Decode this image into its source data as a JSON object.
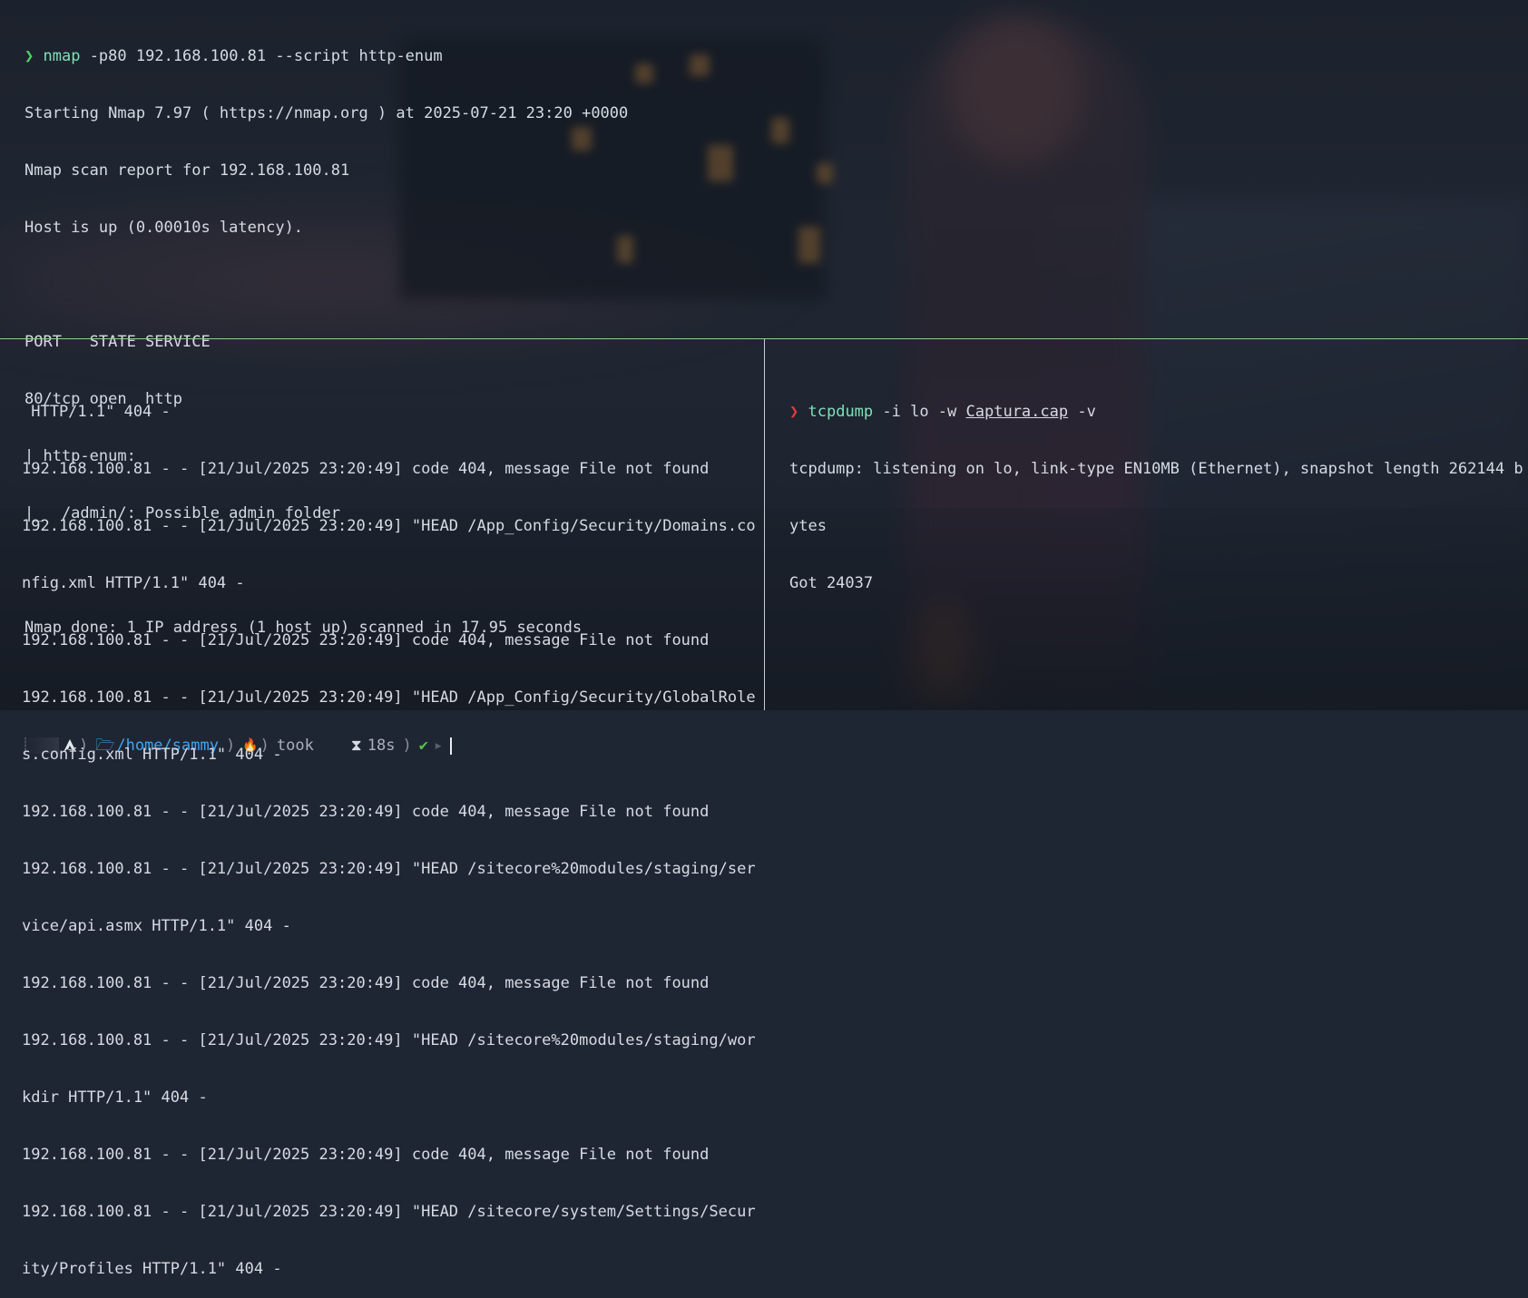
{
  "top_pane": {
    "prompt_symbol": "❯",
    "command_name": "nmap",
    "command_args": " -p80 192.168.100.81 --script http-enum",
    "output": [
      "Starting Nmap 7.97 ( https://nmap.org ) at 2025-07-21 23:20 +0000",
      "Nmap scan report for 192.168.100.81",
      "Host is up (0.00010s latency).",
      "",
      "PORT   STATE SERVICE",
      "80/tcp open  http",
      "| http-enum:",
      "|_  /admin/: Possible admin folder",
      "",
      "Nmap done: 1 IP address (1 host up) scanned in 17.95 seconds"
    ],
    "status_prompt": {
      "os_icon": "arch-linux-icon",
      "folder_icon": "folder-icon",
      "path": "/home/sammy",
      "fire_icon": "fire-icon",
      "took_label": "took",
      "hourglass_icon": "hourglass-icon",
      "duration": "18s",
      "status_icon": "check-icon",
      "separator": ")"
    }
  },
  "left_pane": {
    "lines": [
      " HTTP/1.1\" 404 -",
      "192.168.100.81 - - [21/Jul/2025 23:20:49] code 404, message File not found",
      "192.168.100.81 - - [21/Jul/2025 23:20:49] \"HEAD /App_Config/Security/Domains.co",
      "nfig.xml HTTP/1.1\" 404 -",
      "192.168.100.81 - - [21/Jul/2025 23:20:49] code 404, message File not found",
      "192.168.100.81 - - [21/Jul/2025 23:20:49] \"HEAD /App_Config/Security/GlobalRole",
      "s.config.xml HTTP/1.1\" 404 -",
      "192.168.100.81 - - [21/Jul/2025 23:20:49] code 404, message File not found",
      "192.168.100.81 - - [21/Jul/2025 23:20:49] \"HEAD /sitecore%20modules/staging/ser",
      "vice/api.asmx HTTP/1.1\" 404 -",
      "192.168.100.81 - - [21/Jul/2025 23:20:49] code 404, message File not found",
      "192.168.100.81 - - [21/Jul/2025 23:20:49] \"HEAD /sitecore%20modules/staging/wor",
      "kdir HTTP/1.1\" 404 -",
      "192.168.100.81 - - [21/Jul/2025 23:20:49] code 404, message File not found",
      "192.168.100.81 - - [21/Jul/2025 23:20:49] \"HEAD /sitecore/system/Settings/Secur",
      "ity/Profiles HTTP/1.1\" 404 -"
    ]
  },
  "right_pane": {
    "prompt_symbol": "❯",
    "command_name": "tcpdump",
    "arg_before_file": " -i lo -w ",
    "file_name": "Captura.cap",
    "arg_after_file": " -v",
    "output": [
      "tcpdump: listening on lo, link-type EN10MB (Ethernet), snapshot length 262144 b",
      "ytes",
      "Got 24037"
    ]
  },
  "colors": {
    "prompt_ok": "#50d364",
    "prompt_error": "#e03c3c",
    "command": "#7fe0b8",
    "path": "#3fa6f0",
    "text": "#d6dae3",
    "pane_divider": "#8fd08a"
  }
}
